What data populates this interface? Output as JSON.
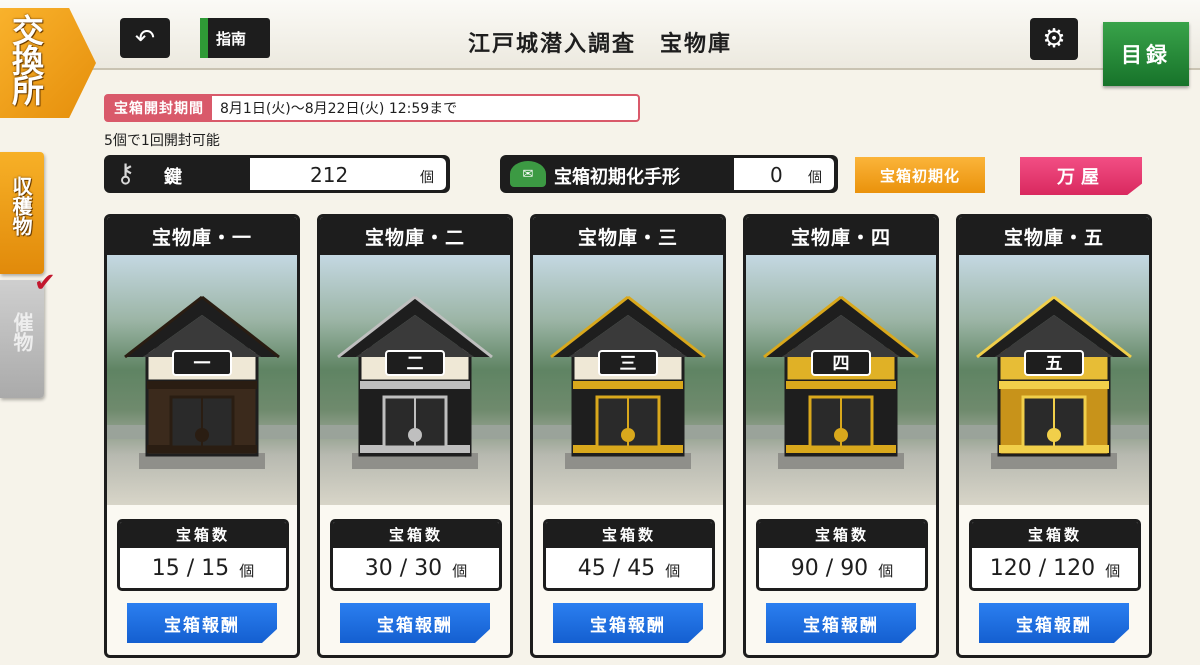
{
  "header": {
    "exchange_tab": "交換所",
    "guide_label": "指南",
    "title": "江戸城潜入調査　宝物庫",
    "catalog_label": "目録",
    "back_icon": "back-arrow-icon",
    "settings_icon": "gear-icon"
  },
  "side_tabs": [
    {
      "label": "収穫物",
      "active": true
    },
    {
      "label": "催物",
      "active": false
    }
  ],
  "period": {
    "label": "宝箱開封期間",
    "value": "8月1日(火)〜8月22日(火) 12:59まで"
  },
  "open_note": "5個で1回開封可能",
  "resources": {
    "key": {
      "label": "鍵",
      "count": "212",
      "unit": "個",
      "icon": "key-icon"
    },
    "reset_ticket": {
      "label": "宝箱初期化手形",
      "count": "0",
      "unit": "個",
      "icon": "ticket-icon"
    }
  },
  "buttons": {
    "reset_chest": "宝箱初期化",
    "shop": "万屋"
  },
  "vaults": [
    {
      "title": "宝物庫・一",
      "numeral": "一",
      "count_label": "宝箱数",
      "count": "15 / 15",
      "unit": "個",
      "reward": "宝箱報酬",
      "body": "#3b2a1c",
      "trim": "#2a1d12",
      "wall": "#efe8d6"
    },
    {
      "title": "宝物庫・二",
      "numeral": "二",
      "count_label": "宝箱数",
      "count": "30 / 30",
      "unit": "個",
      "reward": "宝箱報酬",
      "body": "#1e1e1e",
      "trim": "#bfbfbf",
      "wall": "#efe8d6"
    },
    {
      "title": "宝物庫・三",
      "numeral": "三",
      "count_label": "宝箱数",
      "count": "45 / 45",
      "unit": "個",
      "reward": "宝箱報酬",
      "body": "#1e1e1e",
      "trim": "#d9a81c",
      "wall": "#efe8d6"
    },
    {
      "title": "宝物庫・四",
      "numeral": "四",
      "count_label": "宝箱数",
      "count": "90 / 90",
      "unit": "個",
      "reward": "宝箱報酬",
      "body": "#1e1e1e",
      "trim": "#d9a81c",
      "wall": "#e0b126"
    },
    {
      "title": "宝物庫・五",
      "numeral": "五",
      "count_label": "宝箱数",
      "count": "120 / 120",
      "unit": "個",
      "reward": "宝箱報酬",
      "body": "#c8931a",
      "trim": "#f1cf4a",
      "wall": "#e7bd36"
    }
  ]
}
